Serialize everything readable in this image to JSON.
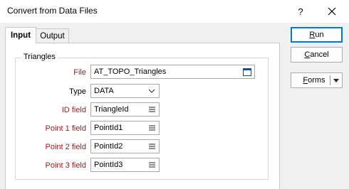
{
  "window": {
    "title": "Convert from Data Files",
    "help": "?"
  },
  "tabs": [
    {
      "label": "Input"
    },
    {
      "label": "Output"
    }
  ],
  "group": {
    "label": "Triangles"
  },
  "fields": {
    "file": {
      "label": "File",
      "value": "AT_TOPO_Triangles"
    },
    "type": {
      "label": "Type",
      "value": "DATA"
    },
    "id_field": {
      "label": "ID field",
      "value": "TriangleId"
    },
    "point1": {
      "label": "Point 1 field",
      "value": "PointId1"
    },
    "point2": {
      "label": "Point 2 field",
      "value": "PointId2"
    },
    "point3": {
      "label": "Point 3 field",
      "value": "PointId3"
    }
  },
  "buttons": {
    "run": {
      "mnemonic": "R",
      "rest": "un"
    },
    "cancel": {
      "mnemonic": "C",
      "rest": "ancel"
    },
    "forms": {
      "mnemonic": "F",
      "rest": "orms"
    }
  },
  "colors": {
    "required_label": "#9b1b1b",
    "default_button_border": "#0078d7"
  }
}
